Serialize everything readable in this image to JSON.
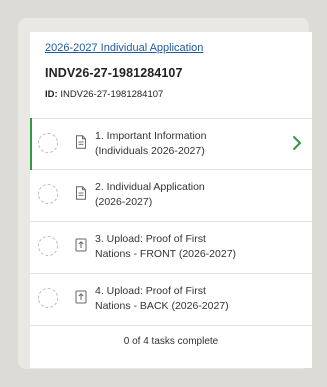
{
  "application": {
    "link_text": "2026-2027 Individual Application",
    "title": "INDV26-27-1981284107",
    "id_label": "ID:",
    "id_value": "INDV26-27-1981284107"
  },
  "tasks": [
    {
      "label_line1": "1. Important Information",
      "label_line2": "(Individuals 2026-2027)",
      "icon": "document-icon",
      "active": true
    },
    {
      "label_line1": "2. Individual Application",
      "label_line2": "(2026-2027)",
      "icon": "document-icon",
      "active": false
    },
    {
      "label_line1": "3. Upload: Proof of First",
      "label_line2": "Nations - FRONT (2026-2027)",
      "icon": "upload-icon",
      "active": false
    },
    {
      "label_line1": "4. Upload: Proof of First",
      "label_line2": "Nations - BACK (2026-2027)",
      "icon": "upload-icon",
      "active": false
    }
  ],
  "footer": {
    "progress_text": "0 of 4 tasks complete",
    "completed": 0,
    "total": 4
  },
  "colors": {
    "link": "#1f5a9c",
    "active_accent": "#2e9a43"
  }
}
